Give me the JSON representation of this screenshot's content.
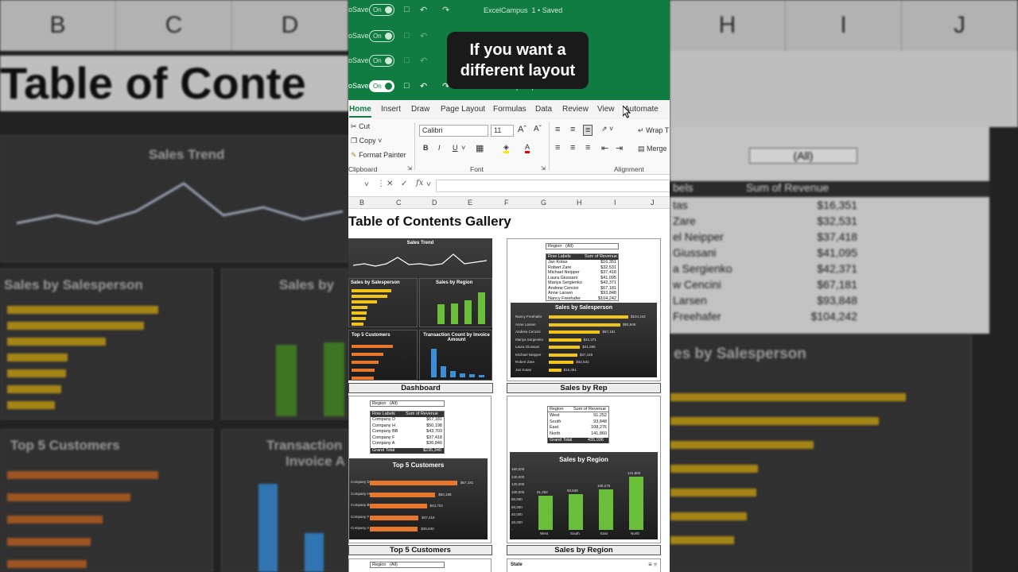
{
  "caption": {
    "line1": "If you want a",
    "line2": "different layout"
  },
  "titlebar": {
    "autosave_label": "oSave",
    "toggle_label": "On",
    "doc_title": "ExcelCampus",
    "saved_status": "1 • Saved",
    "doc_title_short": "ExcelCampus",
    "saved_short": "Saved"
  },
  "tabs": [
    "Home",
    "Insert",
    "Draw",
    "Page Layout",
    "Formulas",
    "Data",
    "Review",
    "View",
    "Automate"
  ],
  "ribbon": {
    "cut": "Cut",
    "copy": "Copy",
    "format_painter": "Format Painter",
    "clipboard": "Clipboard",
    "font_name": "Calibri",
    "font_size": "11",
    "font_group": "Font",
    "wrap": "Wrap T",
    "merge": "Merge",
    "alignment": "Alignment",
    "bold": "B",
    "italic": "I",
    "underline": "U"
  },
  "formula_bar": {
    "fx": "fx"
  },
  "columns": [
    "B",
    "C",
    "D",
    "E",
    "F",
    "G",
    "H",
    "I",
    "J"
  ],
  "sheet_title": "Table of Contents Gallery",
  "cards": {
    "dashboard": {
      "label": "Dashboard",
      "trend_title": "Sales Trend",
      "panel_rep": "Sales by Salesperson",
      "panel_region": "Sales by Region",
      "panel_top5": "Top 5 Customers",
      "panel_txn": "Transaction Count by Invoice Amount",
      "trend_values": [
        "$8K",
        "$13K",
        "$7K",
        "$13K",
        "$22K",
        "$12K",
        "$11K",
        "$13K",
        "$14K",
        "$28K",
        "$16K",
        "$12K"
      ],
      "region_values": [
        "91,252",
        "93,848",
        "108,276",
        "141,860"
      ]
    },
    "sales_by_rep": {
      "label": "Sales by Rep",
      "filter_label": "Region",
      "filter_value": "(All)",
      "table_header": [
        "Row Labels",
        "Sum of Revenue"
      ],
      "rows": [
        [
          "Jan Kotas",
          "$16,351"
        ],
        [
          "Robert Zare",
          "$32,531"
        ],
        [
          "Michael Neipper",
          "$37,418"
        ],
        [
          "Laura Giussani",
          "$41,095"
        ],
        [
          "Mariya Sergienko",
          "$42,371"
        ],
        [
          "Andrew Cencini",
          "$67,181"
        ],
        [
          "Anne Larsen",
          "$93,848"
        ],
        [
          "Nancy Freehafer",
          "$104,242"
        ]
      ],
      "chart_title": "Sales by Salesperson"
    },
    "top5": {
      "label": "Top 5 Customers",
      "filter_label": "Region",
      "filter_value": "(All)",
      "table_header": [
        "Row Labels",
        "Sum of Revenue"
      ],
      "rows": [
        [
          "Company D",
          "$67,181"
        ],
        [
          "Company H",
          "$50,198"
        ],
        [
          "Company BB",
          "$43,703"
        ],
        [
          "Company F",
          "$37,418"
        ],
        [
          "Company A",
          "$36,840"
        ]
      ],
      "total": [
        "Grand Total",
        "$235,340"
      ],
      "chart_title": "Top 5 Customers"
    },
    "sales_by_region": {
      "label": "Sales by Region",
      "table_header": [
        "Region",
        "Sum of Revenue"
      ],
      "rows": [
        [
          "West",
          "91,252"
        ],
        [
          "South",
          "93,848"
        ],
        [
          "East",
          "108,276"
        ],
        [
          "North",
          "141,860"
        ]
      ],
      "total": [
        "Grand Total",
        "435,036"
      ],
      "chart_title": "Sales by Region",
      "y_ticks": [
        "160,000",
        "140,000",
        "120,000",
        "100,000",
        "80,000",
        "60,000",
        "40,000",
        "20,000",
        "-"
      ]
    },
    "bottom_left": {
      "filter_label": "Region",
      "filter_value": "(All)"
    },
    "bottom_right": {
      "slicer_title": "State"
    }
  },
  "bg_left": {
    "cols": [
      "B",
      "C",
      "D"
    ],
    "title": "Table of Conte",
    "trend": "Sales Trend",
    "panel1": "Sales by Salesperson",
    "panel2": "Sales by",
    "panel3": "Top 5 Customers",
    "panel4": "Transaction",
    "panel4b": "Invoice A"
  },
  "bg_right": {
    "cols": [
      "H",
      "I",
      "J"
    ],
    "filter": "(All)",
    "hdr1": "bels",
    "hdr2": "Sum of Revenue",
    "rows": [
      [
        "tas",
        "$16,351"
      ],
      [
        "Zare",
        "$32,531"
      ],
      [
        "el Neipper",
        "$37,418"
      ],
      [
        "Giussani",
        "$41,095"
      ],
      [
        "a Sergienko",
        "$42,371"
      ],
      [
        "w Cencini",
        "$67,181"
      ],
      [
        "Larsen",
        "$93,848"
      ],
      [
        "Freehafer",
        "$104,242"
      ]
    ],
    "chart": "es by Salesperson"
  },
  "colors": {
    "excel_green": "#107c41",
    "gold": "#f0c419",
    "orange": "#e8772e",
    "green_bar": "#6abf3a",
    "blue_bar": "#3b8fd9"
  }
}
